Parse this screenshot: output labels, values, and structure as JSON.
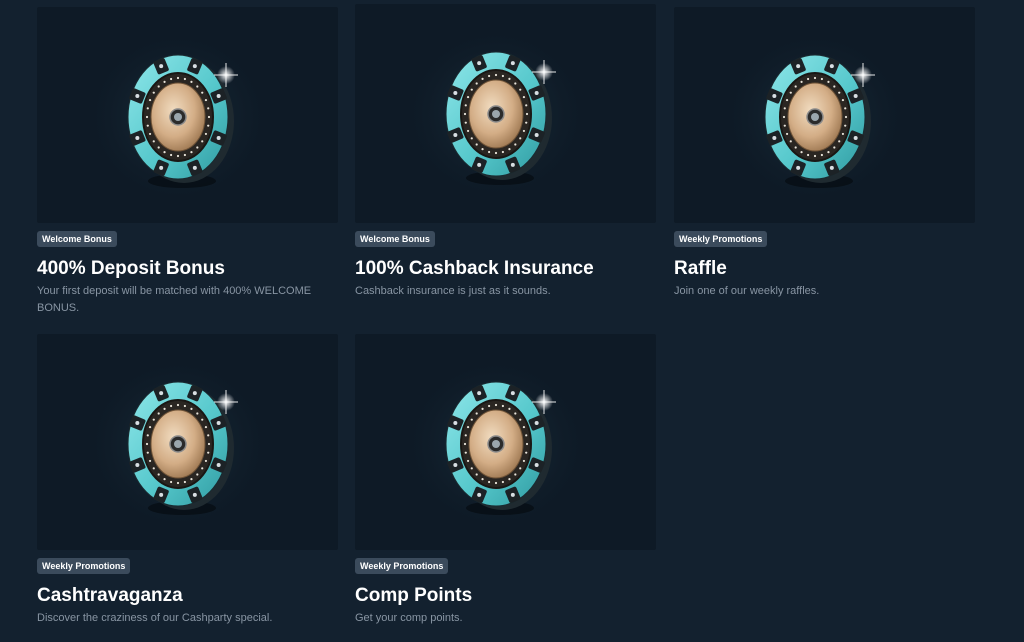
{
  "promotions": [
    {
      "badge": "Welcome Bonus",
      "title": "400% Deposit Bonus",
      "description": "Your first deposit will be matched with 400% WELCOME BONUS.",
      "image_icon": "casino-chip-icon"
    },
    {
      "badge": "Welcome Bonus",
      "title": "100% Cashback Insurance",
      "description": "Cashback insurance is just as it sounds.",
      "image_icon": "casino-chip-icon"
    },
    {
      "badge": "Weekly Promotions",
      "title": "Raffle",
      "description": "Join one of our weekly raffles.",
      "image_icon": "casino-chip-icon"
    },
    {
      "badge": "Weekly Promotions",
      "title": "Cashtravaganza",
      "description": "Discover the craziness of our Cashparty special.",
      "image_icon": "casino-chip-icon"
    },
    {
      "badge": "Weekly Promotions",
      "title": "Comp Points",
      "description": "Get your comp points.",
      "image_icon": "casino-chip-icon"
    }
  ],
  "colors": {
    "page_background": "#13212f",
    "card_background": "#0e1a26",
    "badge_background": "#3b4b5c",
    "chip_accent": "#5fd3d6",
    "chip_center": "#dcb995"
  }
}
